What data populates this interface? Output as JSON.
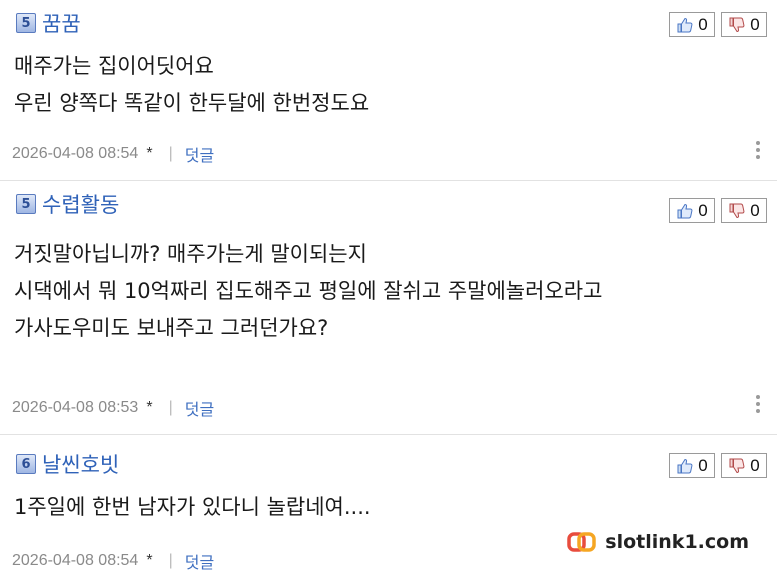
{
  "comments": [
    {
      "level": "5",
      "nickname": "꿈꿈",
      "likes": "0",
      "dislikes": "0",
      "lines": [
        "매주가는 집이어딧어요",
        "우린 양쪽다 똑같이 한두달에 한번정도요"
      ],
      "timestamp": "2026-04-08 08:54",
      "star": "*",
      "separator": "|",
      "reply_label": "덧글"
    },
    {
      "level": "5",
      "nickname": "수렵활동",
      "likes": "0",
      "dislikes": "0",
      "lines": [
        "거짓말아닙니까? 매주가는게 말이되는지",
        "시댁에서 뭐 10억짜리 집도해주고 평일에 잘쉬고 주말에놀러오라고",
        "가사도우미도 보내주고 그러던가요?"
      ],
      "timestamp": "2026-04-08 08:53",
      "star": "*",
      "separator": "|",
      "reply_label": "덧글"
    },
    {
      "level": "6",
      "nickname": "날씬호빗",
      "likes": "0",
      "dislikes": "0",
      "lines": [
        "1주일에 한번 남자가 있다니 놀랍네여...."
      ],
      "timestamp": "2026-04-08 08:54",
      "star": "*",
      "separator": "|",
      "reply_label": "덧글"
    }
  ],
  "watermark": {
    "text": "slotlink1.com"
  },
  "icons": {
    "like": "thumbs-up-icon",
    "dislike": "thumbs-down-icon",
    "more": "more-vertical-icon",
    "level": "level-badge-icon"
  },
  "colors": {
    "nickname": "#2f62b8",
    "reply": "#3f6fc0",
    "meta": "#8a8a8a"
  }
}
